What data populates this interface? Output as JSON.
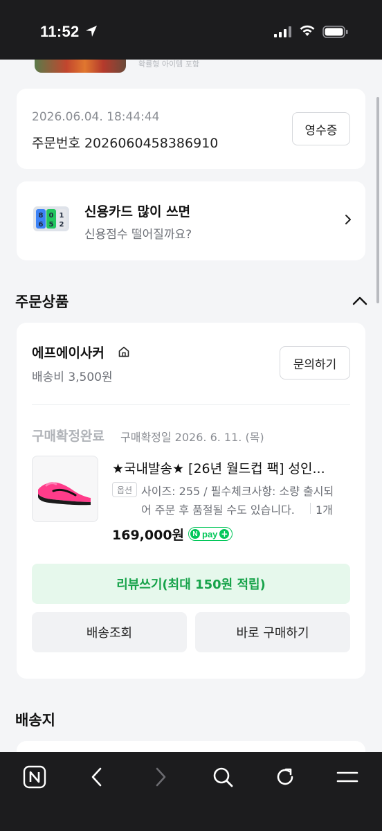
{
  "status_bar": {
    "time": "11:52"
  },
  "banner": {
    "note": "확률형 아이템 포함"
  },
  "order": {
    "date": "2026.06.04. 18:44:44",
    "number": "주문번호 2026060458386910",
    "receipt_label": "영수증"
  },
  "ad": {
    "title": "신용카드 많이 쓰면",
    "subtitle": "신용점수 떨어질까요?"
  },
  "sections": {
    "order_items": "주문상품",
    "address": "배송지"
  },
  "seller": {
    "name": "에프에이사커",
    "shipping_fee": "배송비 3,500원",
    "inquiry_label": "문의하기"
  },
  "product": {
    "status": "구매확정완료",
    "confirm_date": "구매확정일 2026. 6. 11. (목)",
    "title": "★국내발송★ [26년 월드컵 팩] 성인...",
    "option_badge": "옵션",
    "option_line1": "사이즈: 255 / 필수체크사항: 소량 출시되",
    "option_line2": "어 주문 후 품절될 수도 있습니다.",
    "quantity": "1개",
    "price": "169,000원",
    "npay_label": "pay"
  },
  "actions": {
    "review": "리뷰쓰기(최대 150원 적립)",
    "track": "배송조회",
    "buy_again": "바로 구매하기"
  },
  "colors": {
    "accent_green": "#17a34a",
    "npay_green": "#03c75a",
    "background": "#f4f5f7"
  },
  "icons": {
    "nav": [
      "naver-icon",
      "back-icon",
      "forward-icon",
      "search-icon",
      "refresh-icon",
      "menu-icon"
    ]
  }
}
